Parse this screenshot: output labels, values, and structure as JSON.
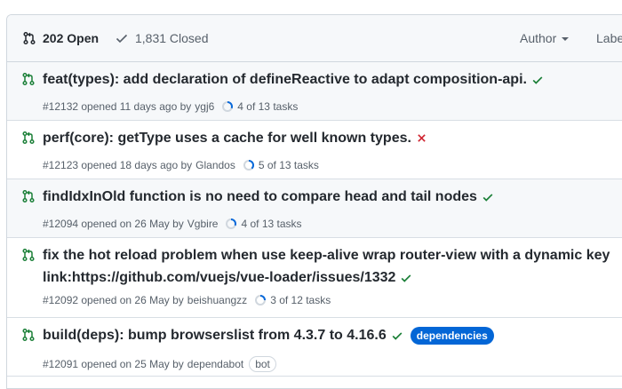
{
  "header": {
    "open_label": "202 Open",
    "closed_label": "1,831 Closed",
    "filters": {
      "author": "Author",
      "label": "Label"
    }
  },
  "colors": {
    "open_icon": "#1a7f37",
    "success": "#1a7f37",
    "failure": "#cf222e",
    "label_bg": "#0366d6",
    "task_ring": "#0969da"
  },
  "pulls": [
    {
      "title": "feat(types): add declaration of defineReactive to adapt composition-api.",
      "status": "success",
      "meta": "#12132 opened 11 days ago by",
      "author": "ygj6",
      "tasks": "4 of 13 tasks",
      "task_progress": 0.31
    },
    {
      "title": "perf(core): getType uses a cache for well known types.",
      "status": "failure",
      "meta": "#12123 opened 18 days ago by",
      "author": "Glandos",
      "tasks": "5 of 13 tasks",
      "task_progress": 0.38
    },
    {
      "title": "findIdxInOld function is no need to compare head and tail nodes",
      "status": "success",
      "meta": "#12094 opened on 26 May by",
      "author": "Vgbire",
      "tasks": "4 of 13 tasks",
      "task_progress": 0.31
    },
    {
      "title": "fix the hot reload problem when use keep-alive wrap router-view with a dynamic key link:https://github.com/vuejs/vue-loader/issues/1332",
      "status": "success",
      "meta": "#12092 opened on 26 May by",
      "author": "beishuangzz",
      "tasks": "3 of 12 tasks",
      "task_progress": 0.25
    },
    {
      "title": "build(deps): bump browserslist from 4.3.7 to 4.16.6",
      "status": "success",
      "meta": "#12091 opened on 25 May by",
      "author": "dependabot",
      "label": "dependencies",
      "badge": "bot"
    }
  ],
  "icons": {
    "pr": "git-pull-request-icon",
    "check": "check-icon",
    "x": "x-icon",
    "progress": "progress-ring-icon"
  }
}
